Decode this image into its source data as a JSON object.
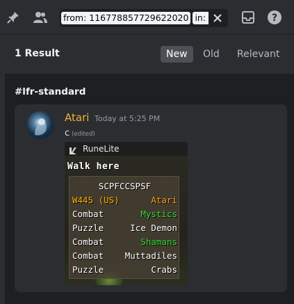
{
  "toolbar": {
    "search_chips": [
      "from: 116778857729622020",
      "in: lfr"
    ],
    "icons": [
      "pin-icon",
      "members-icon",
      "inbox-icon",
      "help-icon"
    ]
  },
  "results": {
    "count_label": "1 Result",
    "sort_tabs": [
      {
        "label": "New",
        "active": true
      },
      {
        "label": "Old",
        "active": false
      },
      {
        "label": "Relevant",
        "active": false
      }
    ],
    "channel": "#lfr-standard"
  },
  "message": {
    "author": "Atari",
    "timestamp": "Today at 5:25 PM",
    "text": "c",
    "edited": "(edited)",
    "author_color": "#f0b232"
  },
  "attachment": {
    "app_title": "RuneLite",
    "hover_text": "Walk here",
    "overlay_title": "SCPFCCSPSF",
    "rows": [
      {
        "left": "W445 (US)",
        "right": "Atari",
        "left_color": "yellow",
        "right_color": "orange"
      },
      {
        "left": "Combat",
        "right": "Mystics",
        "left_color": "white",
        "right_color": "green"
      },
      {
        "left": "Puzzle",
        "right": "Ice Demon",
        "left_color": "white",
        "right_color": "white"
      },
      {
        "left": "Combat",
        "right": "Shamans",
        "left_color": "white",
        "right_color": "green"
      },
      {
        "left": "Combat",
        "right": "Muttadiles",
        "left_color": "white",
        "right_color": "white"
      },
      {
        "left": "Puzzle",
        "right": "Crabs",
        "left_color": "white",
        "right_color": "white"
      }
    ]
  }
}
